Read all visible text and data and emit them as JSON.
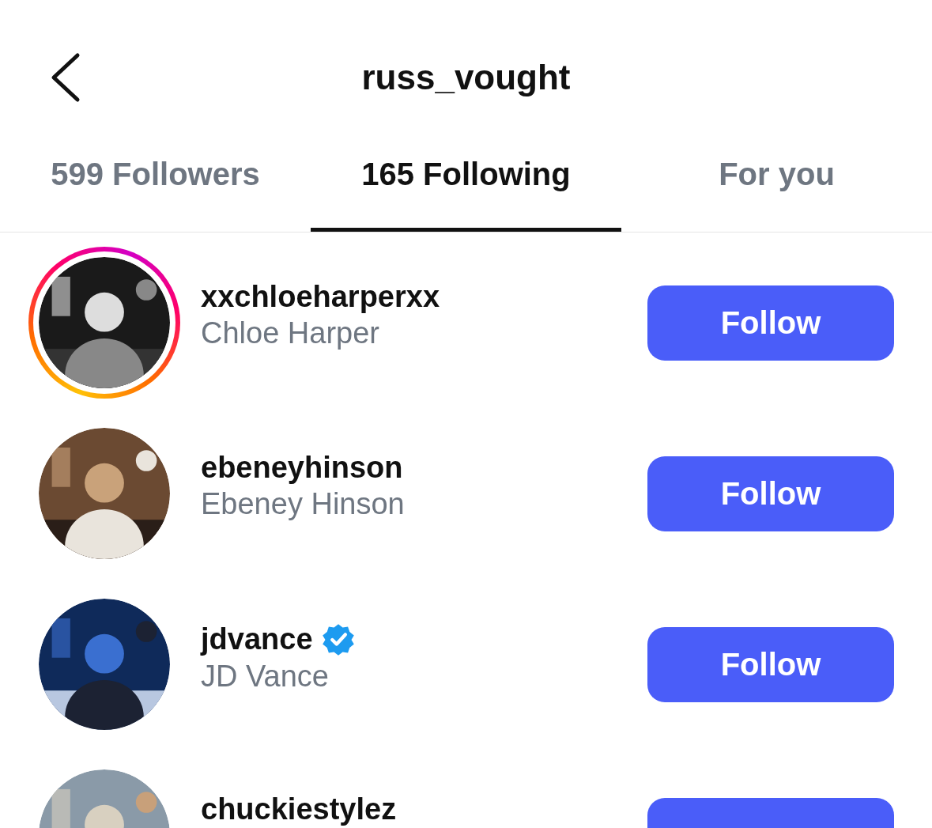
{
  "header": {
    "title": "russ_vought"
  },
  "tabs": [
    {
      "label": "599 Followers",
      "selected": false
    },
    {
      "label": "165 Following",
      "selected": true
    },
    {
      "label": "For you",
      "selected": false
    }
  ],
  "accounts": [
    {
      "username": "xxchloeharperxx",
      "name": "Chloe Harper",
      "story_ring": true,
      "verified": false,
      "button": "Follow"
    },
    {
      "username": "ebeneyhinson",
      "name": "Ebeney Hinson",
      "story_ring": false,
      "verified": false,
      "button": "Follow"
    },
    {
      "username": "jdvance",
      "name": "JD Vance",
      "story_ring": false,
      "verified": true,
      "button": "Follow"
    },
    {
      "username": "chuckiestylez",
      "story_ring": false,
      "verified": false
    }
  ]
}
